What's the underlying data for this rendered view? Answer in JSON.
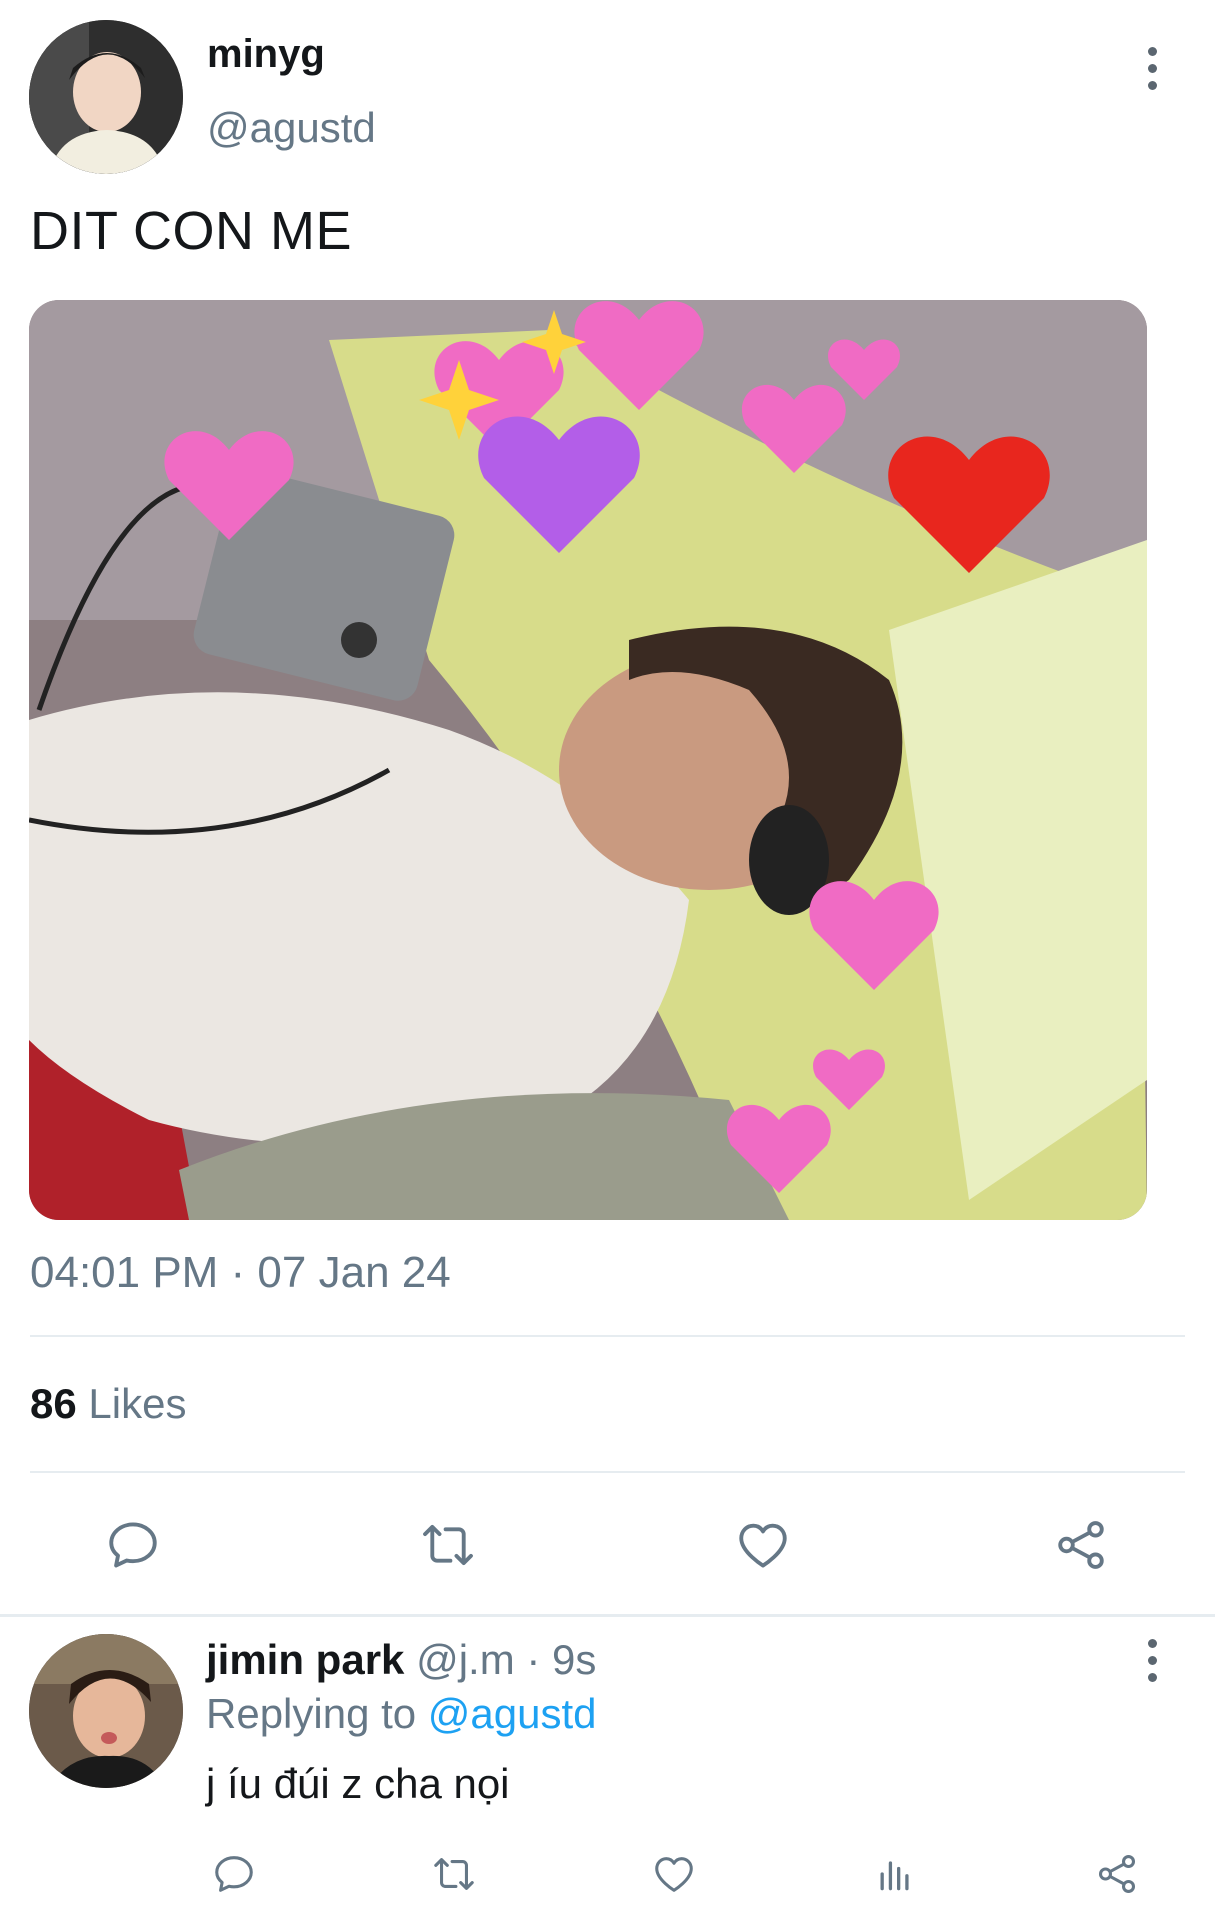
{
  "tweet": {
    "display_name": "minyg",
    "handle": "@agustd",
    "text": "DIT CON ME",
    "timestamp": "04:01 PM · 07 Jan 24",
    "likes_count": "86",
    "likes_label": "Likes"
  },
  "reply": {
    "display_name": "jimin park",
    "handle": "@j.m",
    "separator": " · ",
    "time": "9s",
    "replying_label": "Replying to",
    "replying_to": "@agustd",
    "text": "j íu đúi z cha nọi"
  },
  "icons": {
    "reply": "comment-icon",
    "retweet": "retweet-icon",
    "like": "heart-icon",
    "share": "share-icon",
    "analytics": "analytics-icon",
    "more": "more-vertical-icon"
  },
  "colors": {
    "text_primary": "#14171a",
    "text_secondary": "#657786",
    "accent": "#1da1f2",
    "icon": "#657786",
    "divider": "#e6ecf0"
  }
}
